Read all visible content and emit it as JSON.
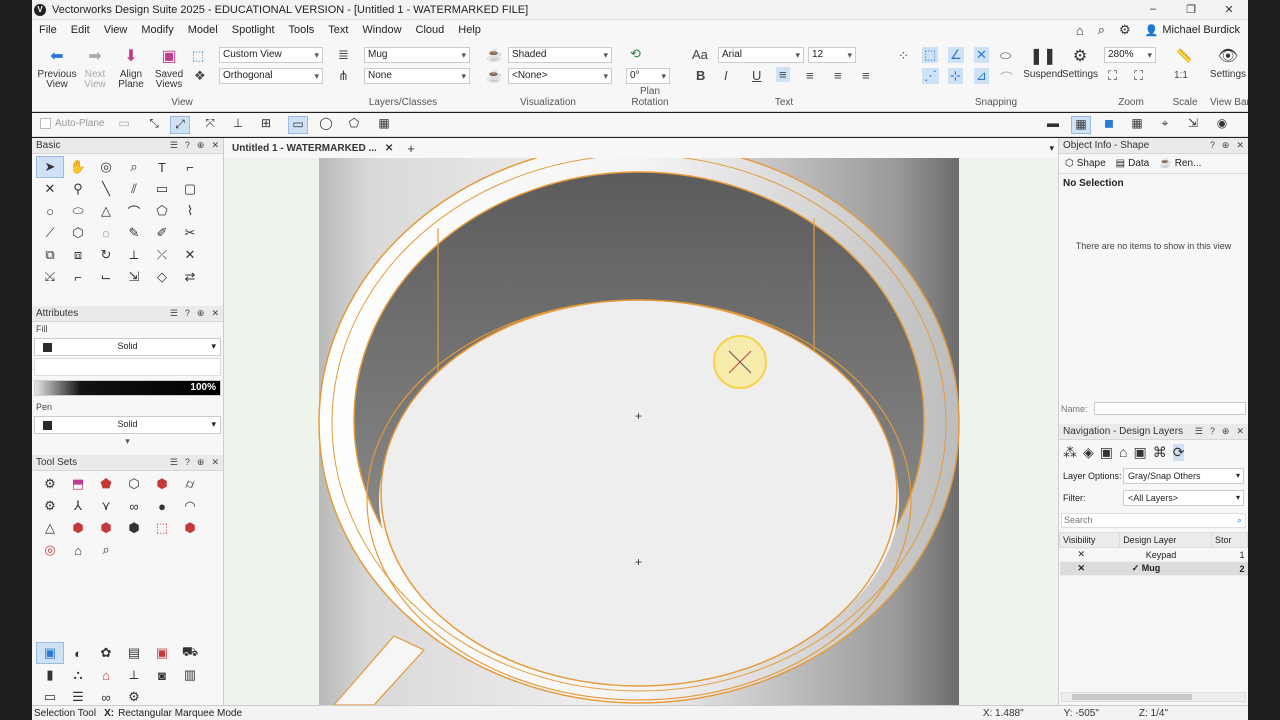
{
  "app": {
    "title": "Vectorworks Design Suite 2025 - EDUCATIONAL VERSION - [Untitled 1 - WATERMARKED FILE]",
    "logo": "V",
    "window_controls": [
      "–",
      "❐",
      "✕"
    ]
  },
  "menu": {
    "items": [
      "File",
      "Edit",
      "View",
      "Modify",
      "Model",
      "Spotlight",
      "Tools",
      "Text",
      "Window",
      "Cloud",
      "Help"
    ],
    "user_name": "Michael Burdick"
  },
  "ribbon": {
    "view": {
      "previous_view": "Previous View",
      "next_view": "Next View",
      "align_plane": "Align Plane",
      "saved_views": "Saved Views",
      "view_dropdown": "Custom View",
      "projection_dropdown": "Orthogonal",
      "group_label": "View"
    },
    "layers_classes": {
      "layer": "Mug",
      "class": "None",
      "group_label": "Layers/Classes"
    },
    "visualization": {
      "render_mode": "Shaded",
      "light": "<None>",
      "group_label": "Visualization"
    },
    "plan_rotation": {
      "value": "0°",
      "group_label": "Plan Rotation"
    },
    "text": {
      "font": "Arial",
      "size": "12",
      "group_label": "Text"
    },
    "snapping": {
      "suspend_label": "Suspend",
      "settings_label": "Settings",
      "group_label": "Snapping"
    },
    "zoom": {
      "value": "280%",
      "group_label": "Zoom"
    },
    "scale": {
      "value": "1:1",
      "group_label": "Scale"
    },
    "view_bar": {
      "settings_label": "Settings",
      "group_label": "View Bar"
    }
  },
  "toolrow": {
    "auto_plane": "Auto-Plane"
  },
  "left_panels": {
    "basic": {
      "title": "Basic"
    },
    "attributes": {
      "title": "Attributes",
      "fill_label": "Fill",
      "fill_style": "Solid",
      "opacity": "100%",
      "pen_label": "Pen",
      "pen_style": "Solid"
    },
    "tool_sets": {
      "title": "Tool Sets"
    }
  },
  "document": {
    "tab_title": "Untitled 1 - WATERMARKED ...",
    "add_tab": "+"
  },
  "object_info": {
    "title": "Object Info - Shape",
    "tabs": [
      "Shape",
      "Data",
      "Ren..."
    ],
    "selection": "No Selection",
    "empty_message": "There are no items to show in this view",
    "name_label": "Name:"
  },
  "navigation": {
    "title": "Navigation - Design Layers",
    "layer_options_label": "Layer Options:",
    "layer_options_value": "Gray/Snap Others",
    "filter_label": "Filter:",
    "filter_value": "<All Layers>",
    "search_placeholder": "Search",
    "columns": [
      "Visibility",
      "Design Layer",
      "Stor"
    ],
    "rows": [
      {
        "visibility": "✕",
        "check": "",
        "name": "Keypad",
        "stack": "1"
      },
      {
        "visibility": "✕",
        "check": "✓",
        "name": "Mug",
        "stack": "2"
      }
    ]
  },
  "status": {
    "tool": "Selection Tool",
    "mode_key": "X:",
    "mode": "Rectangular Marquee Mode",
    "x": "X: 1.488\"",
    "y": "Y: -505\"",
    "z": "Z: 1/4\""
  },
  "colors": {
    "accent": "#2a7ad1",
    "edge_highlight": "#e59a3a",
    "canvas_bg": "#eef4ec"
  }
}
